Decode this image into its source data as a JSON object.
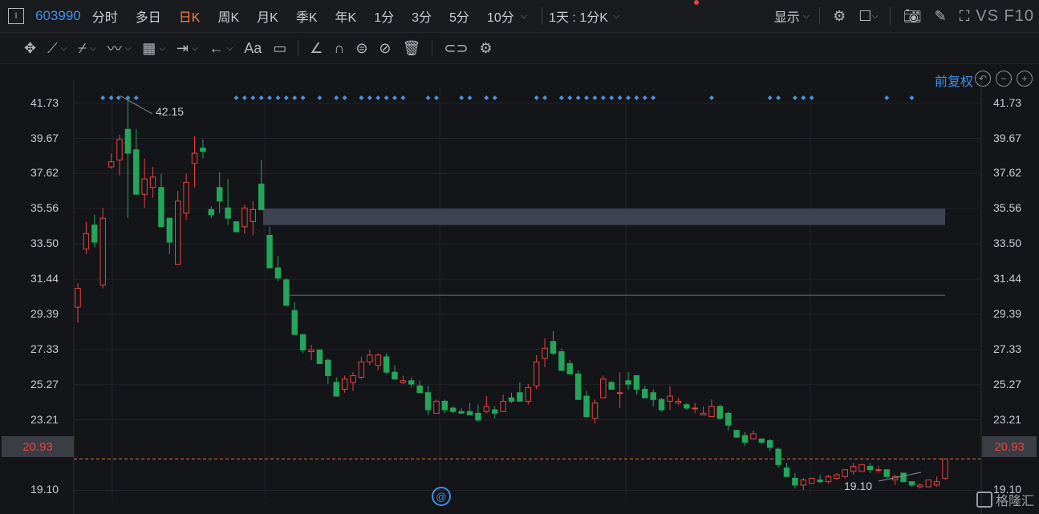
{
  "header": {
    "stock_code": "603990",
    "periods": [
      "分时",
      "多日",
      "日K",
      "周K",
      "月K",
      "季K",
      "年K",
      "1分",
      "3分",
      "5分",
      "10分"
    ],
    "active_period": "日K",
    "multi_period": "1天 : 1分K",
    "display_label": "显示",
    "f10_label": "VS F10"
  },
  "chart": {
    "adjust_label": "前复权",
    "price_labels": [
      "41.73",
      "39.67",
      "37.62",
      "35.56",
      "33.50",
      "31.44",
      "29.39",
      "27.33",
      "25.27",
      "23.21",
      "20.93",
      "19.10"
    ],
    "current_price": "20.93",
    "high_annotation": "42.15",
    "low_annotation": "19.10",
    "watermark": "格隆汇",
    "up_color": "#e84242",
    "down_color": "#23a55a"
  },
  "chart_data": {
    "type": "candlestick",
    "ohlc": [
      [
        29.8,
        31.2,
        28.9,
        30.9
      ],
      [
        33.2,
        34.8,
        32.9,
        34.1
      ],
      [
        34.6,
        35.2,
        33.3,
        33.6
      ],
      [
        31.1,
        35.6,
        30.9,
        35.0
      ],
      [
        38.0,
        38.8,
        37.9,
        38.3
      ],
      [
        38.4,
        39.9,
        37.5,
        39.6
      ],
      [
        40.2,
        42.15,
        35.0,
        38.8
      ],
      [
        39.0,
        40.2,
        36.5,
        36.4
      ],
      [
        36.4,
        38.5,
        35.6,
        37.3
      ],
      [
        36.8,
        38.0,
        36.2,
        37.4
      ],
      [
        36.8,
        37.6,
        35.0,
        34.5
      ],
      [
        35.0,
        34.6,
        32.9,
        33.6
      ],
      [
        32.3,
        36.6,
        32.8,
        36.0
      ],
      [
        35.3,
        37.6,
        34.9,
        37.1
      ],
      [
        38.2,
        39.8,
        36.8,
        38.8
      ],
      [
        39.1,
        39.6,
        38.5,
        38.9
      ],
      [
        35.5,
        35.7,
        35.0,
        35.2
      ],
      [
        36.8,
        37.7,
        35.3,
        36.0
      ],
      [
        35.6,
        37.3,
        34.6,
        35.0
      ],
      [
        34.8,
        34.7,
        34.3,
        34.2
      ],
      [
        34.5,
        35.8,
        34.1,
        35.6
      ],
      [
        34.8,
        36.0,
        34.0,
        35.5
      ],
      [
        37.0,
        38.4,
        35.6,
        35.5
      ],
      [
        34.0,
        34.5,
        32.1,
        32.1
      ],
      [
        32.1,
        32.8,
        31.3,
        31.5
      ],
      [
        31.4,
        31.5,
        29.9,
        29.9
      ],
      [
        29.6,
        30.1,
        28.2,
        28.2
      ],
      [
        28.2,
        28.2,
        27.1,
        27.3
      ],
      [
        27.2,
        27.6,
        26.7,
        27.3
      ],
      [
        27.3,
        27.2,
        26.5,
        26.5
      ],
      [
        26.7,
        26.8,
        25.3,
        25.8
      ],
      [
        25.4,
        25.7,
        24.6,
        24.6
      ],
      [
        25.0,
        25.8,
        24.8,
        25.6
      ],
      [
        25.4,
        26.0,
        24.9,
        25.8
      ],
      [
        25.7,
        26.9,
        25.6,
        26.6
      ],
      [
        26.6,
        27.3,
        26.4,
        27.0
      ],
      [
        26.4,
        27.1,
        26.1,
        27.0
      ],
      [
        26.9,
        27.1,
        25.9,
        26.0
      ],
      [
        26.0,
        26.4,
        25.6,
        25.6
      ],
      [
        25.4,
        25.8,
        25.3,
        25.5
      ],
      [
        25.5,
        25.7,
        25.1,
        25.3
      ],
      [
        25.2,
        25.5,
        24.8,
        24.8
      ],
      [
        24.8,
        25.2,
        23.5,
        23.8
      ],
      [
        23.6,
        24.4,
        23.6,
        24.3
      ],
      [
        24.3,
        24.4,
        23.6,
        23.8
      ],
      [
        23.9,
        24.0,
        23.6,
        23.7
      ],
      [
        23.7,
        23.9,
        23.6,
        23.6
      ],
      [
        23.7,
        24.2,
        23.5,
        23.5
      ],
      [
        23.6,
        24.1,
        23.1,
        23.2
      ],
      [
        23.7,
        24.6,
        23.6,
        24.0
      ],
      [
        23.8,
        24.0,
        23.3,
        23.6
      ],
      [
        23.7,
        24.7,
        23.7,
        24.3
      ],
      [
        24.5,
        24.8,
        24.2,
        24.3
      ],
      [
        24.8,
        25.4,
        24.4,
        24.3
      ],
      [
        24.3,
        25.3,
        24.1,
        25.1
      ],
      [
        25.2,
        27.0,
        25.0,
        26.6
      ],
      [
        26.8,
        28.0,
        26.3,
        27.4
      ],
      [
        27.8,
        28.4,
        27.0,
        27.1
      ],
      [
        27.2,
        27.4,
        26.1,
        26.1
      ],
      [
        26.5,
        26.7,
        25.9,
        25.9
      ],
      [
        25.9,
        26.1,
        24.4,
        24.4
      ],
      [
        24.6,
        24.9,
        23.4,
        23.4
      ],
      [
        23.3,
        24.4,
        23.0,
        24.2
      ],
      [
        24.5,
        25.8,
        24.5,
        25.6
      ],
      [
        25.4,
        25.5,
        25.0,
        25.0
      ],
      [
        24.8,
        26.0,
        23.9,
        24.8
      ],
      [
        25.5,
        26.0,
        25.0,
        25.3
      ],
      [
        25.8,
        25.6,
        24.7,
        25.0
      ],
      [
        25.0,
        25.2,
        24.5,
        24.5
      ],
      [
        24.8,
        25.0,
        24.0,
        24.4
      ],
      [
        24.4,
        24.5,
        23.7,
        23.8
      ],
      [
        24.3,
        25.2,
        23.8,
        24.6
      ],
      [
        24.2,
        24.5,
        24.1,
        24.3
      ],
      [
        24.1,
        24.2,
        23.8,
        23.9
      ],
      [
        23.9,
        24.2,
        23.6,
        23.9
      ],
      [
        23.5,
        24.0,
        23.5,
        23.6
      ],
      [
        23.4,
        24.4,
        23.5,
        24.0
      ],
      [
        24.0,
        24.1,
        23.2,
        23.3
      ],
      [
        23.6,
        23.7,
        22.6,
        22.9
      ],
      [
        22.6,
        22.6,
        22.2,
        22.2
      ],
      [
        22.3,
        22.5,
        21.7,
        21.9
      ],
      [
        22.1,
        22.6,
        22.1,
        22.4
      ],
      [
        22.1,
        22.1,
        21.8,
        21.9
      ],
      [
        22.0,
        22.1,
        21.4,
        21.6
      ],
      [
        21.5,
        21.6,
        20.4,
        20.6
      ],
      [
        20.4,
        20.7,
        19.9,
        19.9
      ],
      [
        19.8,
        20.1,
        19.2,
        19.4
      ],
      [
        19.4,
        19.8,
        19.1,
        19.7
      ],
      [
        19.5,
        19.8,
        19.5,
        19.8
      ],
      [
        19.7,
        20.0,
        19.5,
        19.6
      ],
      [
        19.6,
        20.0,
        19.5,
        19.9
      ],
      [
        19.8,
        20.1,
        19.7,
        20.0
      ],
      [
        19.9,
        20.3,
        19.8,
        20.3
      ],
      [
        20.2,
        20.7,
        20.0,
        20.5
      ],
      [
        20.2,
        20.6,
        20.2,
        20.6
      ],
      [
        20.5,
        20.7,
        20.1,
        20.3
      ],
      [
        20.3,
        20.5,
        20.1,
        20.3
      ],
      [
        20.3,
        20.3,
        19.8,
        19.9
      ],
      [
        19.7,
        20.0,
        19.4,
        19.9
      ],
      [
        20.1,
        20.1,
        19.6,
        19.6
      ],
      [
        19.6,
        19.6,
        19.3,
        19.4
      ],
      [
        19.3,
        19.5,
        19.2,
        19.4
      ],
      [
        19.3,
        19.7,
        19.3,
        19.7
      ],
      [
        19.4,
        19.9,
        19.3,
        19.6
      ],
      [
        19.8,
        20.9,
        19.7,
        20.93
      ]
    ],
    "y_range": [
      18.6,
      42.6
    ],
    "hline_price": 30.5,
    "zone": [
      35.56,
      34.6
    ],
    "marker_rows": "blue diamond markers above candles"
  }
}
